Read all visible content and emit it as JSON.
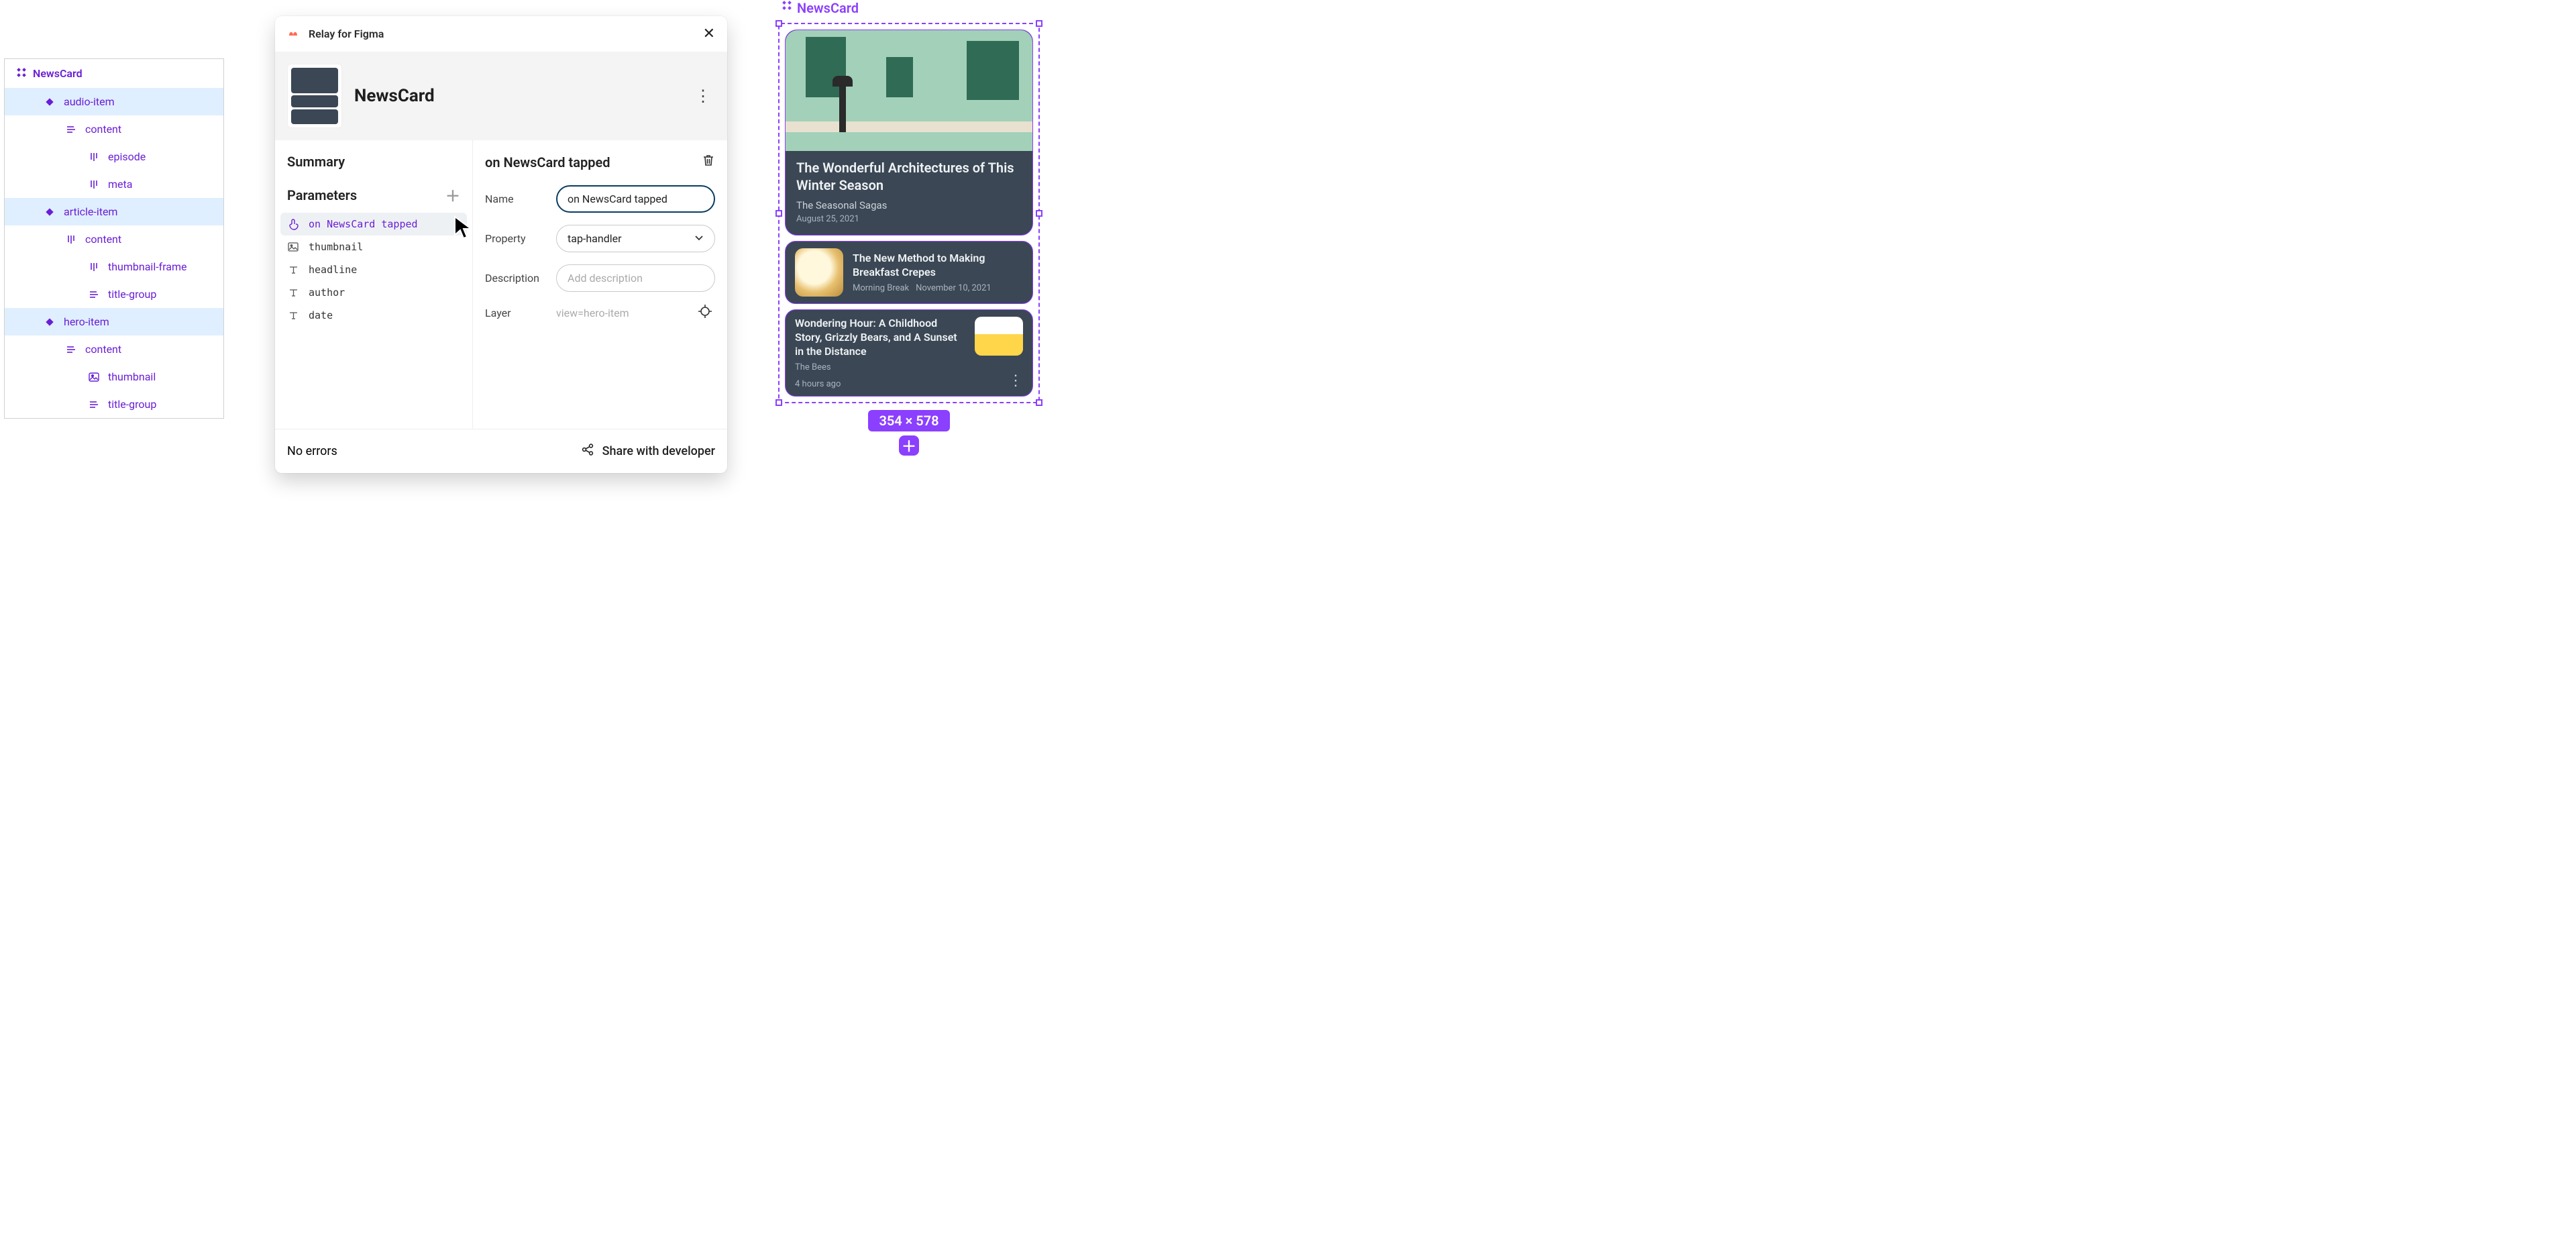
{
  "layers": {
    "root": "NewsCard",
    "items": [
      {
        "label": "audio-item",
        "level": 1,
        "icon": "diamond",
        "sel": true
      },
      {
        "label": "content",
        "level": 2,
        "icon": "stack-h",
        "sel": false
      },
      {
        "label": "episode",
        "level": 3,
        "icon": "stack-v",
        "sel": false
      },
      {
        "label": "meta",
        "level": 3,
        "icon": "stack-v",
        "sel": false
      },
      {
        "label": "article-item",
        "level": 1,
        "icon": "diamond",
        "sel": true
      },
      {
        "label": "content",
        "level": 2,
        "icon": "stack-v",
        "sel": false
      },
      {
        "label": "thumbnail-frame",
        "level": 3,
        "icon": "stack-v",
        "sel": false
      },
      {
        "label": "title-group",
        "level": 3,
        "icon": "stack-h",
        "sel": false
      },
      {
        "label": "hero-item",
        "level": 1,
        "icon": "diamond",
        "sel": true
      },
      {
        "label": "content",
        "level": 2,
        "icon": "stack-h",
        "sel": false
      },
      {
        "label": "thumbnail",
        "level": 3,
        "icon": "image",
        "sel": false
      },
      {
        "label": "title-group",
        "level": 3,
        "icon": "stack-h",
        "sel": false
      }
    ]
  },
  "relay": {
    "brand": "Relay for Figma",
    "component_name": "NewsCard",
    "sections": {
      "summary": "Summary",
      "parameters": "Parameters"
    },
    "params": [
      {
        "icon": "tap",
        "label": "on NewsCard tapped",
        "active": true
      },
      {
        "icon": "img",
        "label": "thumbnail"
      },
      {
        "icon": "text",
        "label": "headline"
      },
      {
        "icon": "text",
        "label": "author"
      },
      {
        "icon": "text",
        "label": "date"
      }
    ],
    "detail": {
      "title": "on NewsCard tapped",
      "name_label": "Name",
      "name_value": "on NewsCard tapped",
      "property_label": "Property",
      "property_value": "tap-handler",
      "description_label": "Description",
      "description_placeholder": "Add description",
      "layer_label": "Layer",
      "layer_value": "view=hero-item"
    },
    "footer": {
      "status": "No errors",
      "share": "Share with developer"
    }
  },
  "canvas": {
    "component_label": "NewsCard",
    "dimensions": "354 × 578",
    "hero": {
      "headline": "The Wonderful Architectures of This Winter Season",
      "author": "The Seasonal Sagas",
      "date": "August 25, 2021"
    },
    "article": {
      "headline": "The New Method to Making Breakfast Crepes",
      "author": "Morning Break",
      "date": "November 10, 2021"
    },
    "audio": {
      "headline": "Wondering Hour: A Childhood Story, Grizzly Bears, and A Sunset in the Distance",
      "author": "The Bees",
      "relative": "4 hours ago"
    }
  }
}
